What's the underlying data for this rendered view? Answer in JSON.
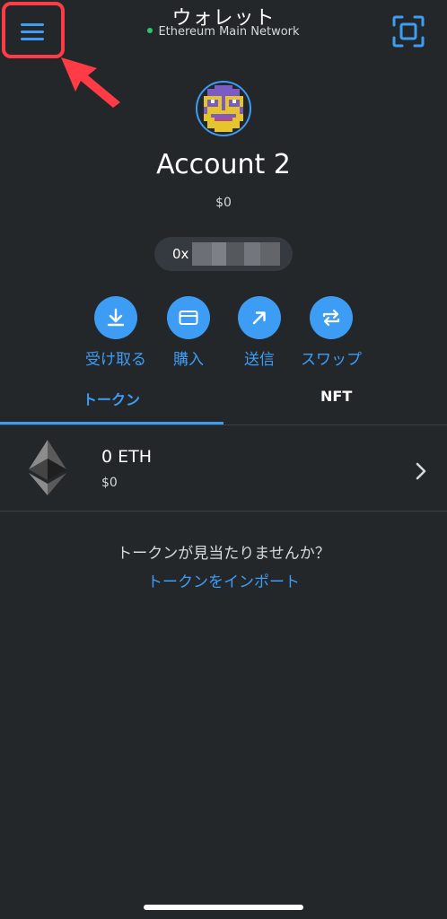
{
  "header": {
    "title": "ウォレット",
    "network": "Ethereum Main Network",
    "network_status_color": "#28c76f",
    "menu_icon": "hamburger-menu-icon",
    "scan_icon": "qr-scan-icon",
    "annotation_color": "#ff3b45"
  },
  "account": {
    "name": "Account 2",
    "balance": "$0",
    "address_prefix": "0x",
    "avatar_icon": "pixel-avatar-icon"
  },
  "actions": [
    {
      "label": "受け取る",
      "icon": "download-icon"
    },
    {
      "label": "購入",
      "icon": "card-icon"
    },
    {
      "label": "送信",
      "icon": "arrow-up-right-icon"
    },
    {
      "label": "スワップ",
      "icon": "swap-icon"
    }
  ],
  "tabs": [
    {
      "label": "トークン",
      "active": true
    },
    {
      "label": "NFT",
      "active": false
    }
  ],
  "tokens": [
    {
      "amount": "0 ETH",
      "fiat": "$0",
      "icon": "ethereum-icon"
    }
  ],
  "empty_state": {
    "question": "トークンが見当たりませんか？",
    "import_link": "トークンをインポート"
  },
  "colors": {
    "background": "#24272a",
    "accent": "#3d9df5",
    "text_primary": "#ffffff",
    "text_secondary": "#d6d9dc"
  }
}
